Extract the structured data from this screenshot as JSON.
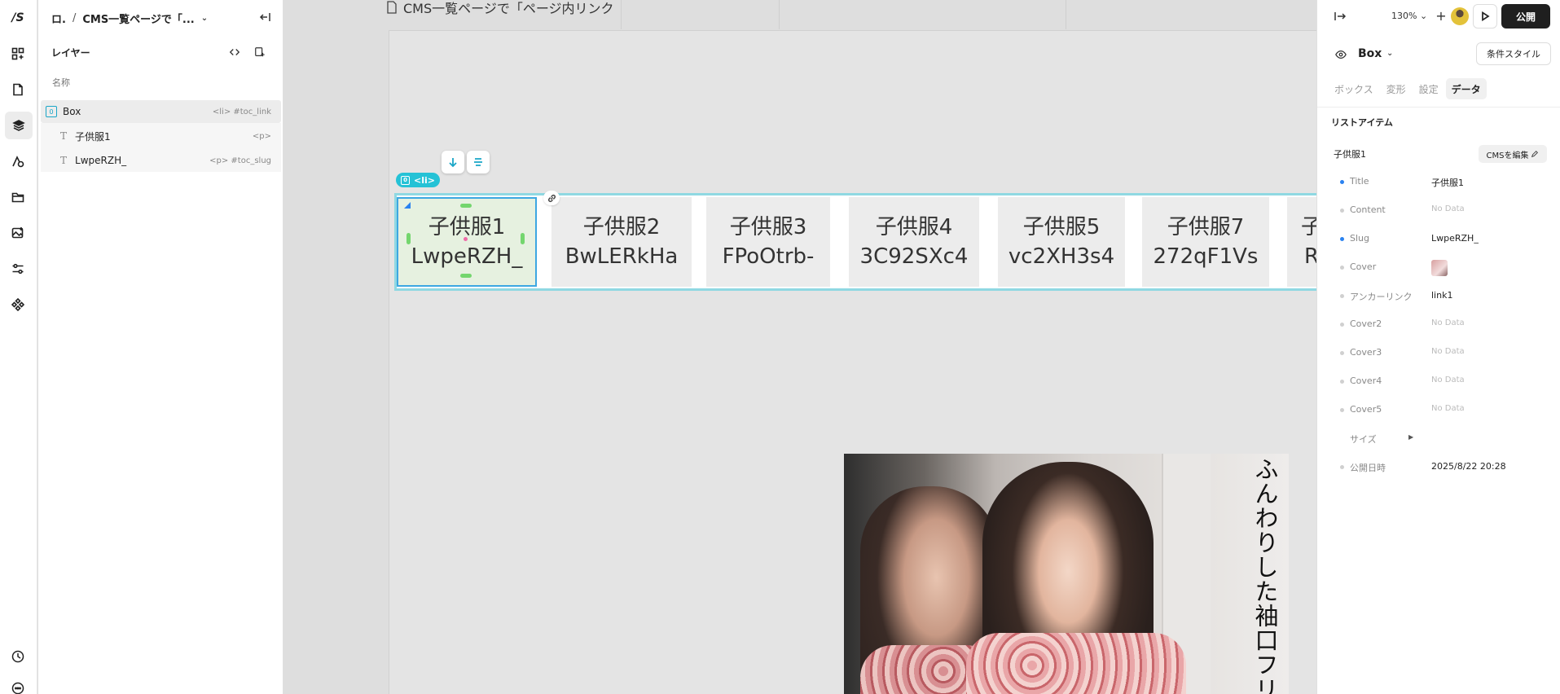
{
  "rail": {
    "logo_text": "/S",
    "icons": [
      "apps-icon",
      "page-icon",
      "layers-icon",
      "assets-icon",
      "folder-icon",
      "image-icon",
      "settings-sliders-icon",
      "components-icon"
    ],
    "bottom_icons": [
      "history-icon",
      "chat-icon"
    ]
  },
  "layers_panel": {
    "breadcrumb_root": "ロ.",
    "breadcrumb_sep": "/",
    "breadcrumb_page": "CMS一覧ページで「...",
    "title": "レイヤー",
    "column_label": "名称",
    "rows": [
      {
        "name": "Box",
        "tag": "<li> #toc_link"
      },
      {
        "name": "子供服1",
        "tag": "<p>"
      },
      {
        "name": "LwpeRZH_",
        "tag": "<p> #toc_slug"
      }
    ]
  },
  "canvas": {
    "page_title": "CMS一覧ページで「ページ内リンク",
    "badge_label": "<li>",
    "cards": [
      {
        "title": "子供服1",
        "slug": "LwpeRZH_"
      },
      {
        "title": "子供服2",
        "slug": "BwLERkHa"
      },
      {
        "title": "子供服3",
        "slug": "FPoOtrb-"
      },
      {
        "title": "子供服4",
        "slug": "3C92SXc4"
      },
      {
        "title": "子供服5",
        "slug": "vc2XH3s4"
      },
      {
        "title": "子供服7",
        "slug": "272qF1Vs"
      },
      {
        "title": "子",
        "slug": "R"
      }
    ],
    "photo_caption": "ふんわりした袖口フリ"
  },
  "topbar": {
    "zoom": "130%",
    "publish_label": "公開"
  },
  "inspector": {
    "element_name": "Box",
    "condition_style_label": "条件スタイル",
    "tabs": [
      "ボックス",
      "変形",
      "設定",
      "データ"
    ],
    "active_tab": "データ",
    "section_title": "リストアイテム",
    "item_name": "子供服1",
    "cms_edit_label": "CMSを編集",
    "fields": [
      {
        "label": "Title",
        "value": "子供服1",
        "bound": true
      },
      {
        "label": "Content",
        "value": "No Data",
        "bound": false
      },
      {
        "label": "Slug",
        "value": "LwpeRZH_",
        "bound": true
      },
      {
        "label": "Cover",
        "value": "",
        "bound": false
      },
      {
        "label": "アンカーリンク",
        "value": "link1",
        "bound": false
      },
      {
        "label": "Cover2",
        "value": "No Data",
        "bound": false
      },
      {
        "label": "Cover3",
        "value": "No Data",
        "bound": false
      },
      {
        "label": "Cover4",
        "value": "No Data",
        "bound": false
      },
      {
        "label": "Cover5",
        "value": "No Data",
        "bound": false
      },
      {
        "label": "サイズ",
        "value": "",
        "bound": false
      },
      {
        "label": "公開日時",
        "value": "2025/8/22 20:28",
        "bound": false
      }
    ]
  }
}
